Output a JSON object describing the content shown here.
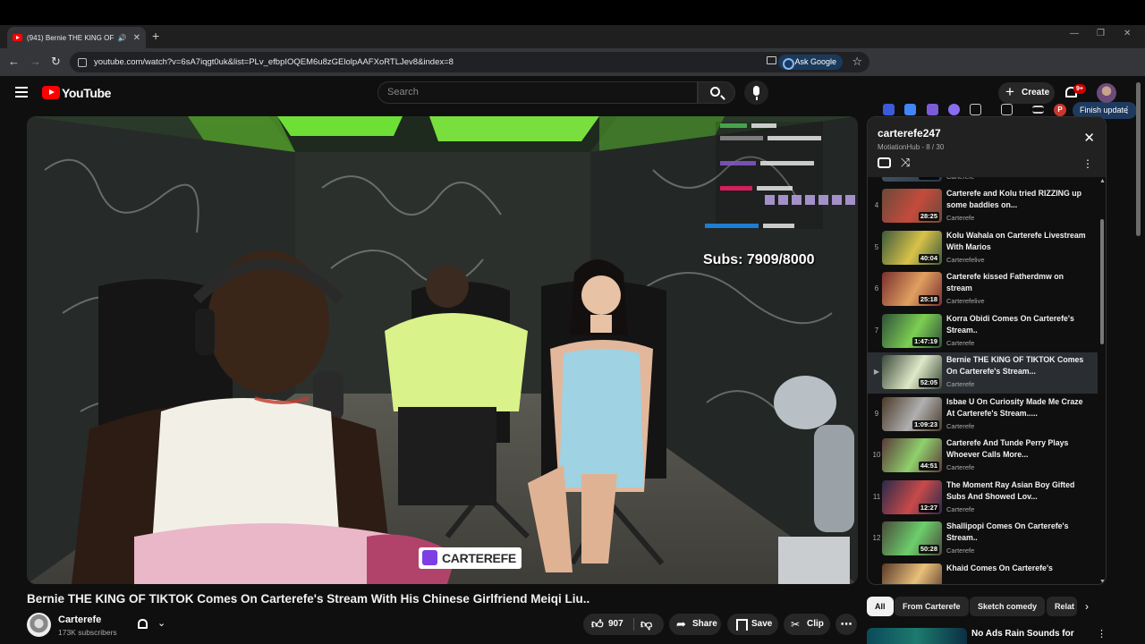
{
  "browser": {
    "tab_title": "(941) Bernie THE KING OF T",
    "url": "youtube.com/watch?v=6sA7iqgt0uk&list=PLv_efbpIOQEM6u8zGElolpAAFXoRTLJev8&index=8",
    "ask_google": "Ask Google",
    "finish_update": "Finish update",
    "profile_letter": "P"
  },
  "header": {
    "logo_text": "YouTube",
    "search_placeholder": "Search",
    "create_label": "Create",
    "notif_badge": "9+"
  },
  "video": {
    "overlay_subs": "Subs: 7909/8000",
    "watermark": "CARTEREFE",
    "title": "Bernie THE KING OF TIKTOK Comes On Carterefe's Stream With His Chinese Girlfriend Meiqi Liu..",
    "channel": "Carterefe",
    "subscribers": "173K subscribers",
    "likes": "907",
    "share_label": "Share",
    "save_label": "Save",
    "clip_label": "Clip"
  },
  "playlist": {
    "title": "carterefe247",
    "subtitle": "MotiationHub - 8 / 30",
    "partial_top": {
      "duration": "36:20",
      "channel": "Carterefe"
    },
    "items": [
      {
        "index": "4",
        "title": "Carterefe and Kolu tried RIZZING up some baddies on...",
        "channel": "Carterefe",
        "duration": "28:25",
        "active": false
      },
      {
        "index": "5",
        "title": "Kolu Wahala on Carterefe Livestream With Marios",
        "channel": "Carterefelive",
        "duration": "40:04",
        "active": false
      },
      {
        "index": "6",
        "title": "Carterefe kissed Fatherdmw on stream",
        "channel": "Carterefelive",
        "duration": "25:18",
        "active": false
      },
      {
        "index": "7",
        "title": "Korra Obidi Comes On Carterefe's Stream..",
        "channel": "Carterefe",
        "duration": "1:47:19",
        "active": false
      },
      {
        "index": "▶",
        "title": "Bernie THE KING OF TIKTOK Comes On Carterefe's Stream...",
        "channel": "Carterefe",
        "duration": "52:05",
        "active": true
      },
      {
        "index": "9",
        "title": "Isbae U On Curiosity Made Me Craze At Carterefe's Stream.....",
        "channel": "Carterefe",
        "duration": "1:09:23",
        "active": false
      },
      {
        "index": "10",
        "title": "Carterefe And Tunde Perry Plays Whoever Calls More...",
        "channel": "Carterefe",
        "duration": "44:51",
        "active": false
      },
      {
        "index": "11",
        "title": "The Moment Ray Asian Boy Gifted Subs And Showed Lov...",
        "channel": "Carterefe",
        "duration": "12:27",
        "active": false
      },
      {
        "index": "12",
        "title": "Shallipopi Comes On Carterefe's Stream..",
        "channel": "Carterefe",
        "duration": "50:28",
        "active": false
      },
      {
        "index": "",
        "title": "Khaid Comes On Carterefe's",
        "channel": "",
        "duration": "",
        "active": false
      }
    ]
  },
  "chips": [
    "All",
    "From Carterefe",
    "Sketch comedy",
    "Relat"
  ],
  "recommendation": {
    "title": "No Ads Rain Sounds for"
  },
  "colors": {
    "accent": "#ff0000",
    "background": "#0f0f0f",
    "chip_active": "#f1f1f1"
  }
}
